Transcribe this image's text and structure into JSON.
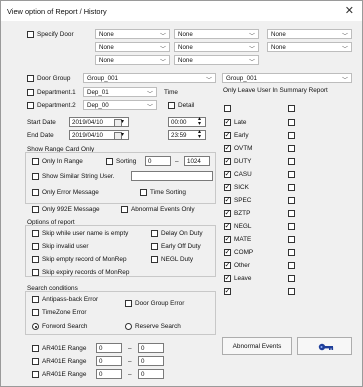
{
  "window": {
    "title": "View option of Report / History",
    "close_glyph": "✕"
  },
  "specify_door": {
    "label": "Specify Door",
    "checked": false,
    "none": "None"
  },
  "door_group": {
    "label": "Door Group",
    "value": "Group_001"
  },
  "department1": {
    "label": "Department.1",
    "value": "Dep_01"
  },
  "department2": {
    "label": "Department.2",
    "value": "Dep_00"
  },
  "time": {
    "label": "Time",
    "detail": "Detail"
  },
  "start": {
    "label": "Start Date",
    "date": "2019/04/10",
    "time": "00:00"
  },
  "end": {
    "label": "End Date",
    "date": "2019/04/10",
    "time": "23:59"
  },
  "range_card": {
    "section": "Show Range Card Only",
    "only_in_range": "Only In Range",
    "sorting": "Sorting",
    "from": "0",
    "to": "1024",
    "dash": "–"
  },
  "similar": {
    "label": "Show Similar String User."
  },
  "only_error": "Only Error Message",
  "time_sorting": "Time Sorting",
  "only_992e": "Only 992E Message",
  "abnormal_only": "Abnormal Events Only",
  "options": {
    "section": "Options of report",
    "skip_user_empty": "Skip while user name is empty",
    "delay_on_duty": "Delay On Duty",
    "skip_invalid_user": "Skip invalid user",
    "early_off_duty": "Early Off Duty",
    "skip_empty_monrep": "Skip empty record of MonRep",
    "negl_duty": "NEGL Duty",
    "skip_expiry_monrep": "Skip expiry records of MonRep"
  },
  "search": {
    "section": "Search conditions",
    "antipass": "Antipass-back Error",
    "door_group_error": "Door Group Error",
    "timezone": "TimeZone Error",
    "forward": "Forword Search",
    "reserve": "Reserve Search"
  },
  "ar401e": {
    "label": "AR401E Range",
    "v1": "0",
    "v2": "0"
  },
  "right": {
    "group_value": "Group_001",
    "leave_header": "Only Leave User In Summary Report",
    "items": [
      "Late",
      "Early",
      "OVTM",
      "DUTY",
      "CASU",
      "SICK",
      "SPEC",
      "BZTP",
      "NEGL",
      "MATE",
      "COMP",
      "Other",
      "Leave"
    ]
  },
  "abnormal_button": "Abnormal Events",
  "colors": {
    "accent": "#1f3f9a"
  }
}
